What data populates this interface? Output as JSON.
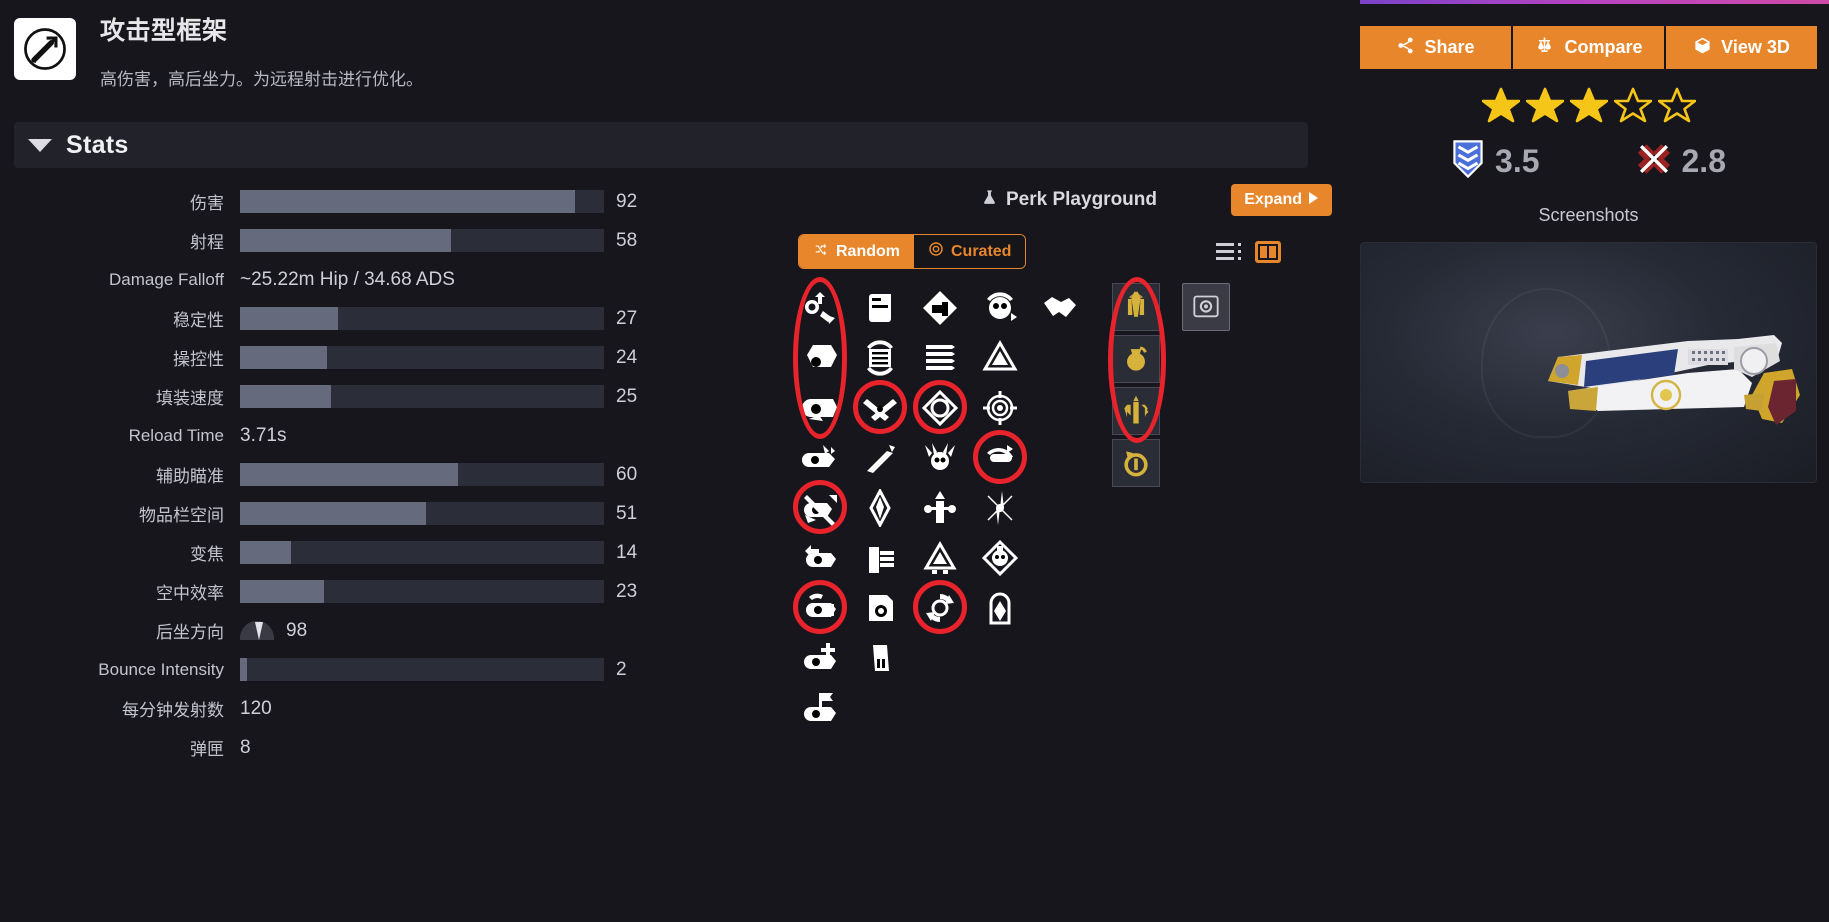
{
  "frame": {
    "icon": "arrow-circle-icon",
    "title": "攻击型框架",
    "description": "高伤害，高后坐力。为远程射击进行优化。"
  },
  "stats_section": {
    "title": "Stats",
    "caret": "caret-down-icon",
    "rows": [
      {
        "label": "伤害",
        "type": "bar",
        "value": "92",
        "pct": 92
      },
      {
        "label": "射程",
        "type": "bar",
        "value": "58",
        "pct": 58
      },
      {
        "label": "Damage Falloff",
        "type": "text",
        "value": "~25.22m Hip / 34.68 ADS"
      },
      {
        "label": "稳定性",
        "type": "bar",
        "value": "27",
        "pct": 27
      },
      {
        "label": "操控性",
        "type": "bar",
        "value": "24",
        "pct": 24
      },
      {
        "label": "填装速度",
        "type": "bar",
        "value": "25",
        "pct": 25
      },
      {
        "label": "Reload Time",
        "type": "text",
        "value": "3.71s"
      },
      {
        "label": "辅助瞄准",
        "type": "bar",
        "value": "60",
        "pct": 60
      },
      {
        "label": "物品栏空间",
        "type": "bar",
        "value": "51",
        "pct": 51
      },
      {
        "label": "变焦",
        "type": "bar",
        "value": "14",
        "pct": 14
      },
      {
        "label": "空中效率",
        "type": "bar",
        "value": "23",
        "pct": 23
      },
      {
        "label": "后坐方向",
        "type": "dial",
        "value": "98",
        "pct": 98
      },
      {
        "label": "Bounce Intensity",
        "type": "bar",
        "value": "2",
        "pct": 2
      },
      {
        "label": "每分钟发射数",
        "type": "text",
        "value": "120"
      },
      {
        "label": "弹匣",
        "type": "text",
        "value": "8"
      }
    ]
  },
  "perk_playground": {
    "title": "Perk Playground",
    "title_icon": "flask-icon",
    "expand_label": "Expand",
    "expand_icon": "chevron-right-icon",
    "toggle": {
      "random_label": "Random",
      "random_icon": "shuffle-icon",
      "curated_label": "Curated",
      "curated_icon": "target-icon",
      "selected": "Random"
    },
    "view_modes": {
      "list_icon": "list-view-icon",
      "column_icon": "column-view-icon",
      "selected": "column"
    },
    "grid_columns": 5,
    "grid_rows": 9,
    "perk_icons": [
      [
        "barrel-arrow-up-icon",
        "magazine-block-icon",
        "fist-diamond-icon",
        "skull-recoil-icon",
        "handshake-icon"
      ],
      [
        "barrel-hex-icon",
        "magazine-cycle-icon",
        "ammo-rows-icon",
        "tri-arrow-icon",
        ""
      ],
      [
        "barrel-smooth-icon",
        "crossed-bullets-icon",
        "diamond-reload-icon",
        "reticle-target-icon",
        ""
      ],
      [
        "barrel-vent-icon",
        "bullet-trace-icon",
        "skull-wings-icon",
        "rounds-cycle-icon",
        ""
      ],
      [
        "barrel-bow-icon",
        "blade-icon",
        "scale-pillar-icon",
        "burst-star-icon",
        ""
      ],
      [
        "barrel-arrow-left-icon",
        "magazine-stack-icon",
        "triangle-peak-icon",
        "skull-diamond-icon",
        ""
      ],
      [
        "barrel-reload-icon",
        "scope-sheet-icon",
        "cycle-arrows-icon",
        "tombstone-icon",
        ""
      ],
      [
        "barrel-plus-icon",
        "magazine-single-icon",
        "",
        "",
        ""
      ],
      [
        "barrel-flag-icon",
        "",
        "",
        "",
        ""
      ]
    ],
    "highlighted_cells": [
      {
        "row": 0,
        "col": 0,
        "shape": "tall-ellipse",
        "span": 3
      },
      {
        "row": 2,
        "col": 1,
        "shape": "circle"
      },
      {
        "row": 2,
        "col": 2,
        "shape": "circle"
      },
      {
        "row": 3,
        "col": 3,
        "shape": "circle"
      },
      {
        "row": 4,
        "col": 0,
        "shape": "circle"
      },
      {
        "row": 6,
        "col": 0,
        "shape": "circle"
      },
      {
        "row": 6,
        "col": 2,
        "shape": "circle"
      }
    ],
    "gold_perks": [
      "fusion-rifle-gold-icon",
      "grenade-gold-icon",
      "trident-gold-icon",
      "reload-clock-gold-icon"
    ],
    "gold_highlight": {
      "from": 0,
      "to": 2,
      "shape": "tall-ellipse"
    },
    "masterwork_perk": "masterwork-square-icon"
  },
  "right_panel": {
    "accent_bar_colors": [
      "#7b43c9",
      "#b944c0",
      "#cf4aa6"
    ],
    "actions": [
      {
        "label": "Share",
        "icon": "share-icon"
      },
      {
        "label": "Compare",
        "icon": "scales-icon"
      },
      {
        "label": "View 3D",
        "icon": "cube-icon"
      }
    ],
    "rating": {
      "stars_total": 5,
      "stars_filled": 3,
      "star_color": "#f5c518",
      "pve": {
        "icon": "chevrons-shield-icon",
        "value": "3.5",
        "color": "#4a6fd8"
      },
      "pvp": {
        "icon": "crossed-swords-icon",
        "value": "2.8",
        "color": "#9b2222"
      }
    },
    "screenshots_label": "Screenshots",
    "screenshot_alt": "hand-cannon-weapon-render"
  },
  "colors": {
    "accent_orange": "#e8862b",
    "annotation_red": "#e8232b",
    "bar_fill": "#656a7c",
    "bar_track": "#2b2d38",
    "page_bg": "#16161c",
    "gold": "#d6b23c"
  }
}
